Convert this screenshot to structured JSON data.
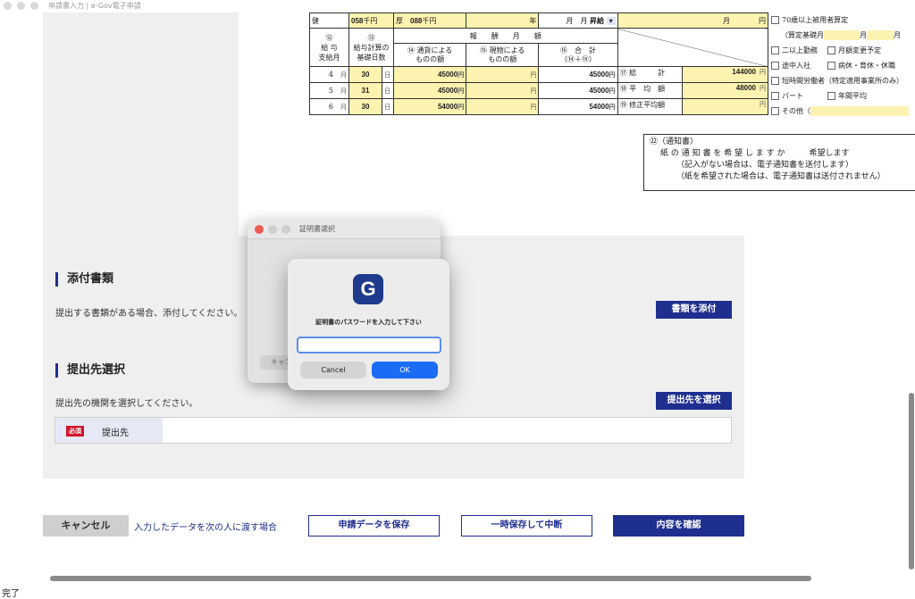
{
  "window": {
    "title": "申請書入力 | e-Gov電子申請"
  },
  "form": {
    "top_row": {
      "kenpo_label": "健",
      "kenpo_value": "058",
      "kenpo_unit": "千円",
      "kosei_label": "厚",
      "kosei_value": "088",
      "kosei_unit": "千円",
      "year_unit": "年",
      "month_unit": "月",
      "month_unit2": "月",
      "shokyu": "昇給",
      "month_unit3": "月",
      "yen": "円"
    },
    "headers": {
      "col12_num": "⑫",
      "col12": "給 与\n支給月",
      "col13_num": "⑬",
      "col13": "給与計算の\n基礎日数",
      "group": "報　　酬　　月　　額",
      "col14": "⑭ 通貨による\nものの額",
      "col15": "⑮ 現物による\nものの額",
      "col16": "⑯　合　計\n（⑭＋⑮）"
    },
    "rows": [
      {
        "month": "4",
        "month_unit": "月",
        "days": "30",
        "days_unit": "日",
        "cash": "45000",
        "kind": "",
        "total": "45000",
        "yen": "円",
        "label": "⑰ 総　　　計",
        "value": "144000"
      },
      {
        "month": "5",
        "month_unit": "月",
        "days": "31",
        "days_unit": "日",
        "cash": "45000",
        "kind": "",
        "total": "45000",
        "yen": "円",
        "label": "⑱ 平　均　額",
        "value": "48000"
      },
      {
        "month": "6",
        "month_unit": "月",
        "days": "30",
        "days_unit": "日",
        "cash": "54000",
        "kind": "",
        "total": "54000",
        "yen": "円",
        "label": "⑲ 修正平均額",
        "value": ""
      }
    ],
    "right_options": {
      "opt70": "70歳以上被用者算定",
      "santei_label": "（算定基礎月",
      "santei_month": "月",
      "month_unit": "月",
      "nijou": "二以上勤務",
      "getsugaku": "月額変更予定",
      "tochu": "途中入社",
      "kyushoku": "病休・育休・休職",
      "tanjikan": "短時間労働者（特定適用事業所のみ）",
      "part": "パート",
      "nenkan": "年間平均",
      "sonota": "その他（"
    },
    "notice": {
      "line1": "㉒（通知書）",
      "line2": "紙 の 通 知 書 を 希 望 し ま す か　　　希望します",
      "line3": "（記入がない場合は、電子通知書を送付します）",
      "line4": "（紙を希望された場合は、電子通知書は送付されません）"
    }
  },
  "attachments": {
    "title": "添付書類",
    "description": "提出する書類がある場合、添付してください。",
    "button": "書類を添付"
  },
  "destination": {
    "title": "提出先選択",
    "description": "提出先の機関を選択してください。",
    "button": "提出先を選択",
    "required_badge": "必須",
    "label": "提出先",
    "value": ""
  },
  "footer": {
    "cancel": "キャンセル",
    "handover_link": "入力したデータを次の人に渡す場合",
    "save": "申請データを保存",
    "pause": "一時保存して中断",
    "confirm": "内容を確認"
  },
  "status_bar": {
    "text": "完了"
  },
  "cert_window": {
    "title": "証明書選択",
    "cancel_partial": "キャン"
  },
  "password_dialog": {
    "app_icon_letter": "G",
    "message": "証明書のパスワードを入力して下さい",
    "input_value": "",
    "cancel": "Cancel",
    "ok": "OK",
    "accent": "#1a6cf5"
  }
}
